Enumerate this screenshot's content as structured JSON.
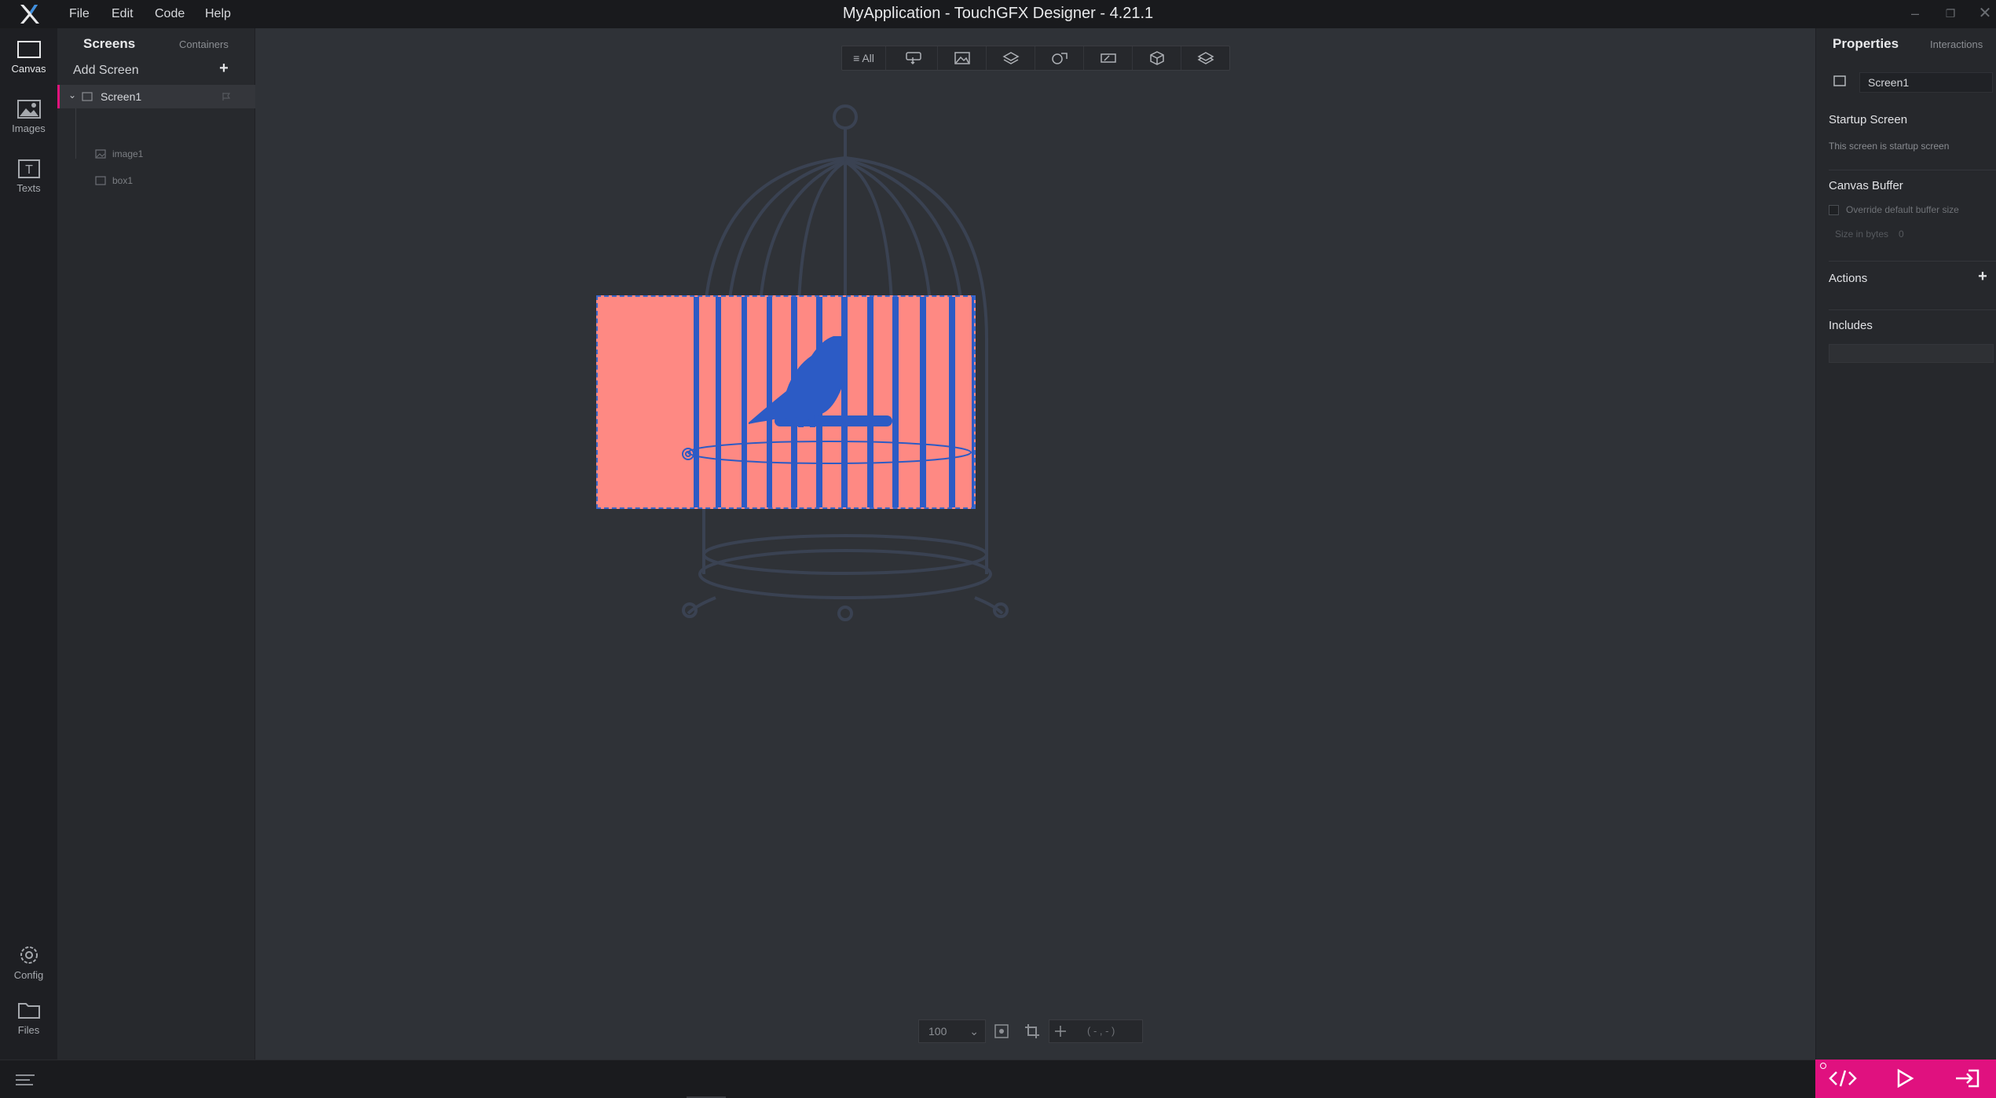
{
  "window": {
    "title": "MyApplication - TouchGFX Designer - 4.21.1",
    "menu": [
      "File",
      "Edit",
      "Code",
      "Help"
    ]
  },
  "leftbar": {
    "items": [
      {
        "label": "Canvas",
        "icon": "canvas-icon"
      },
      {
        "label": "Images",
        "icon": "images-icon"
      },
      {
        "label": "Texts",
        "icon": "texts-icon"
      }
    ],
    "bottom_items": [
      {
        "label": "Config",
        "icon": "gear-icon"
      },
      {
        "label": "Files",
        "icon": "folder-icon"
      }
    ]
  },
  "screens_panel": {
    "tab_active": "Screens",
    "tab_inactive": "Containers",
    "add_screen": "Add Screen",
    "add_plus": "+",
    "tree": {
      "screen": "Screen1",
      "children": [
        "image1",
        "box1"
      ]
    }
  },
  "toolbar": {
    "all_label": "≡ All",
    "icons": [
      "interaction-icon",
      "image-icon",
      "layers-icon",
      "shapes-icon",
      "text-input-icon",
      "3d-icon",
      "containers-icon"
    ]
  },
  "canvas": {
    "screen_bg": "#fe8983",
    "accent": "#3a67c9"
  },
  "bottom": {
    "zoom": "100",
    "coords": "( - , - )"
  },
  "properties": {
    "tab_active": "Properties",
    "tab_inactive": "Interactions",
    "screen_name": "Screen1",
    "startup_title": "Startup Screen",
    "startup_sub": "This screen is startup screen",
    "canvas_buffer_title": "Canvas Buffer",
    "override_label": "Override default buffer size",
    "size_label": "Size in bytes",
    "size_value": "0",
    "actions_title": "Actions",
    "actions_plus": "+",
    "includes_title": "Includes"
  },
  "colors": {
    "brand": "#e0117f",
    "bird": "#2c5bc5"
  }
}
